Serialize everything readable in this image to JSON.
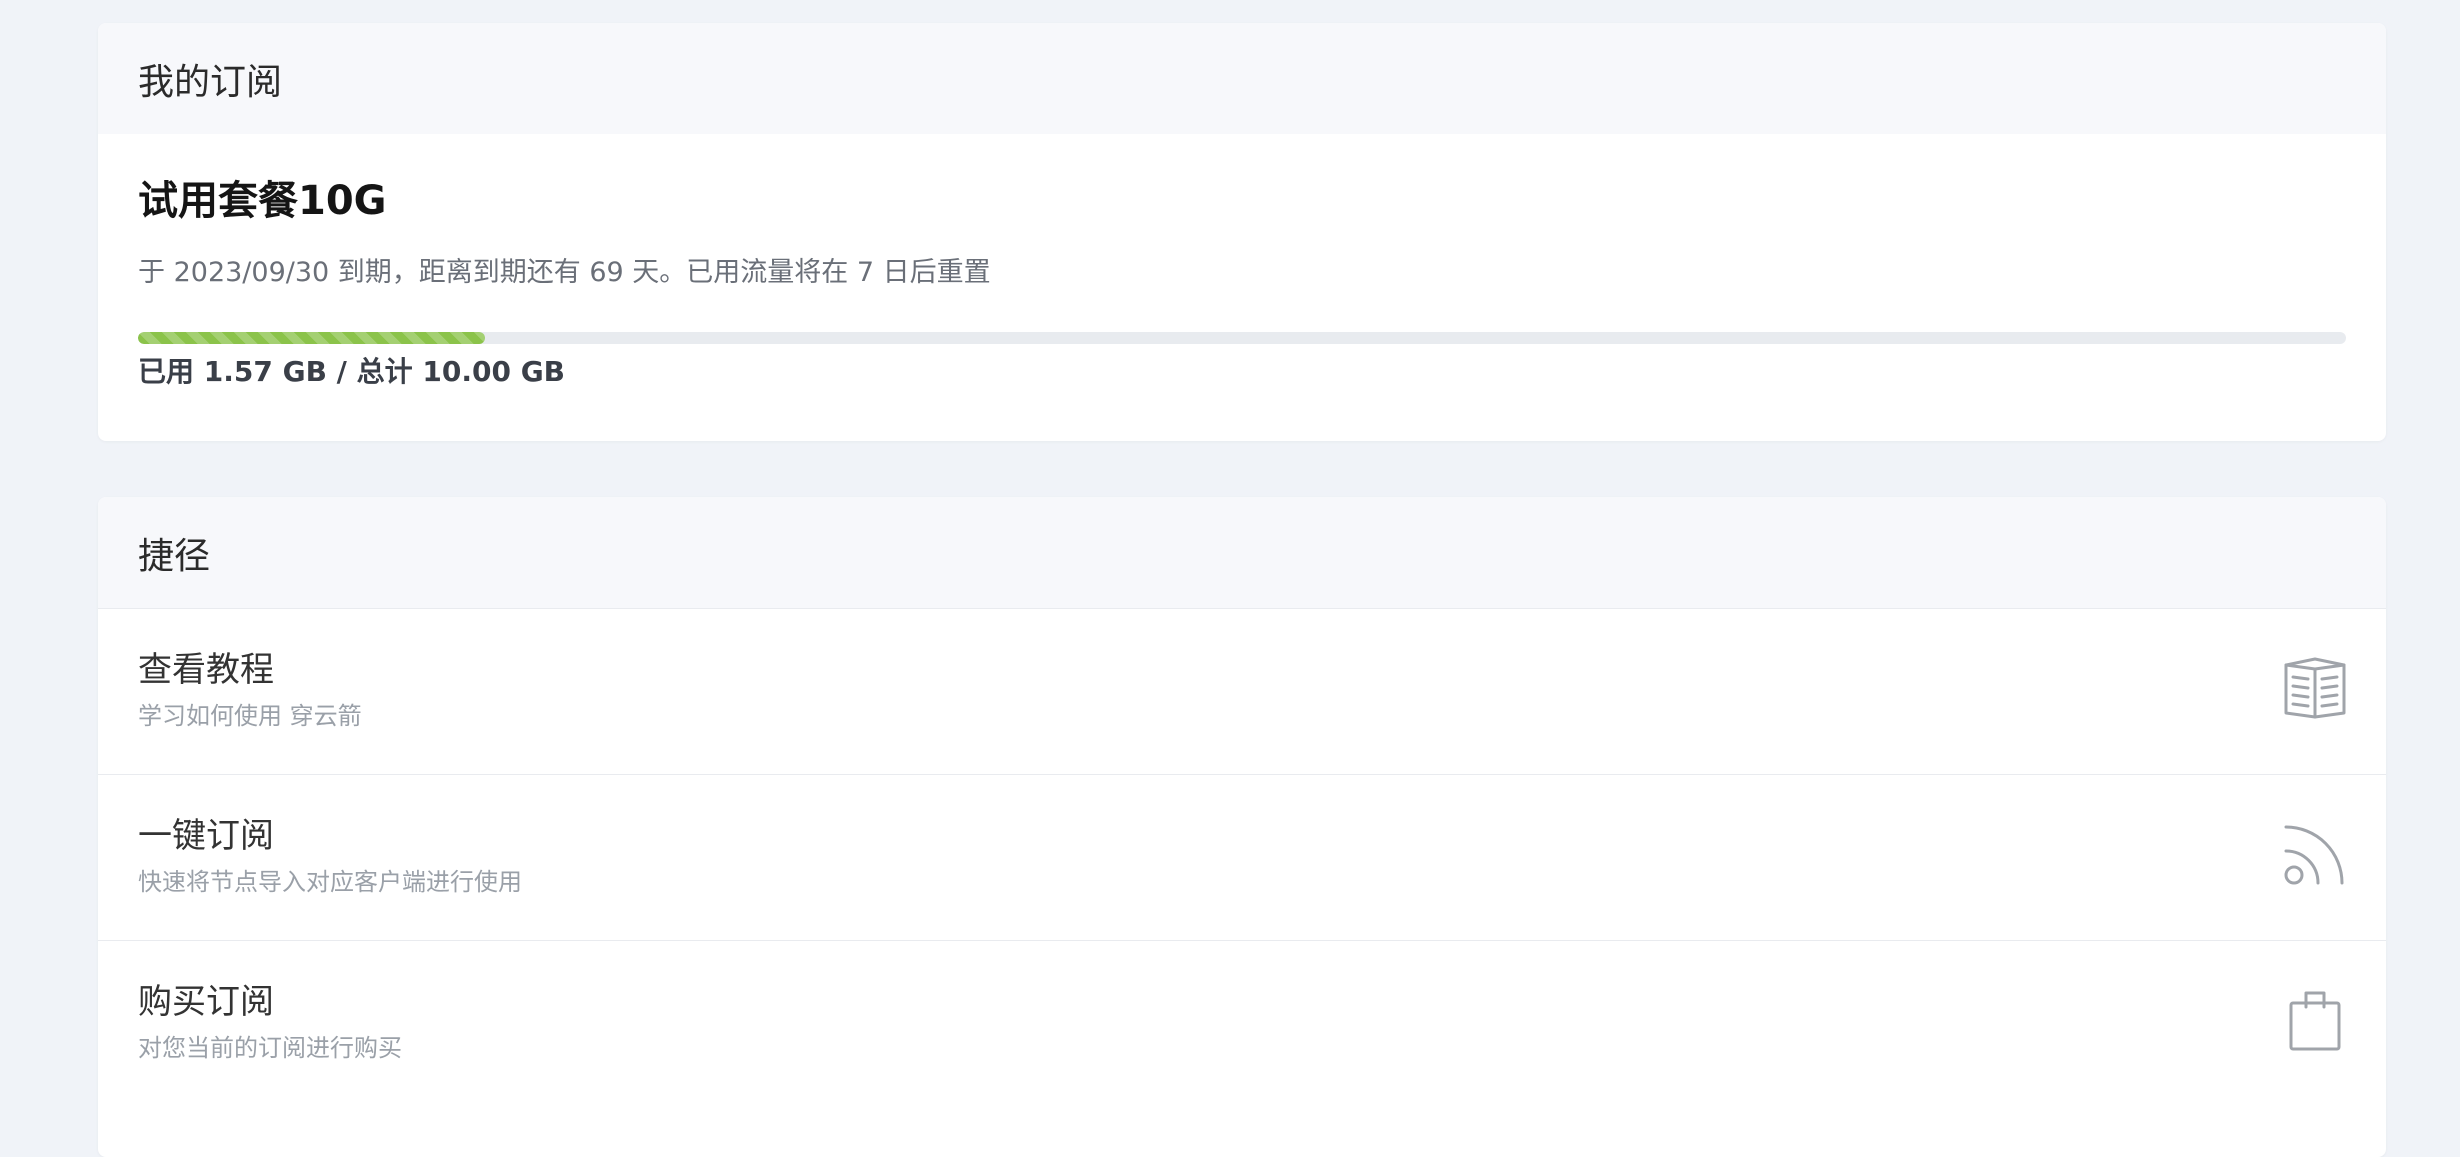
{
  "subscription": {
    "header": "我的订阅",
    "plan_name": "试用套餐10G",
    "expire_text": "于 2023/09/30 到期，距离到期还有 69 天。已用流量将在 7 日后重置",
    "usage_text": "已用 1.57 GB / 总计 10.00 GB",
    "usage_fraction": 0.157,
    "progress_color": "#8bc34a"
  },
  "shortcuts": {
    "header": "捷径",
    "items": [
      {
        "title": "查看教程",
        "desc": "学习如何使用 穿云箭",
        "icon": "book-icon"
      },
      {
        "title": "一键订阅",
        "desc": "快速将节点导入对应客户端进行使用",
        "icon": "rss-icon"
      },
      {
        "title": "购买订阅",
        "desc": "对您当前的订阅进行购买",
        "icon": "shopping-bag-icon"
      }
    ]
  }
}
